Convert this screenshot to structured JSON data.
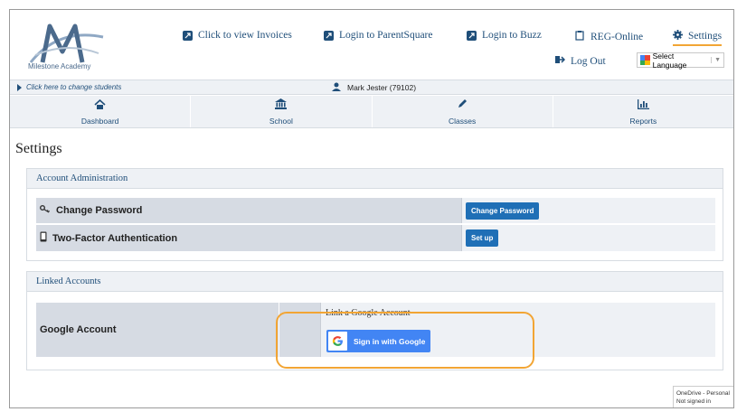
{
  "header": {
    "logo_text": "Milestone Academy",
    "links": {
      "invoices": "Click to view Invoices",
      "parentsquare": "Login to ParentSquare",
      "buzz": "Login to Buzz",
      "reg_online": "REG-Online",
      "settings": "Settings"
    },
    "logout": "Log Out",
    "language_select": "Select Language",
    "language_caret": "▼"
  },
  "student_bar": {
    "change_student": "Click here to change students",
    "student_name": "Mark Jester (79102)"
  },
  "nav": {
    "dashboard": "Dashboard",
    "school": "School",
    "classes": "Classes",
    "reports": "Reports"
  },
  "page_title": "Settings",
  "account_admin": {
    "heading": "Account Administration",
    "change_password_label": "Change Password",
    "change_password_button": "Change Password",
    "two_factor_label": "Two-Factor Authentication",
    "two_factor_button": "Set up"
  },
  "linked_accounts": {
    "heading": "Linked Accounts",
    "google_label": "Google Account",
    "link_text": "Link a Google Account",
    "google_button": "Sign in with Google"
  },
  "onedrive": {
    "line1": "OneDrive - Personal",
    "line2": "Not signed in"
  },
  "colors": {
    "brand_blue": "#1f4e79",
    "button_blue": "#1f6fb6",
    "google_blue": "#4285f4",
    "highlight_orange": "#f2a534"
  }
}
